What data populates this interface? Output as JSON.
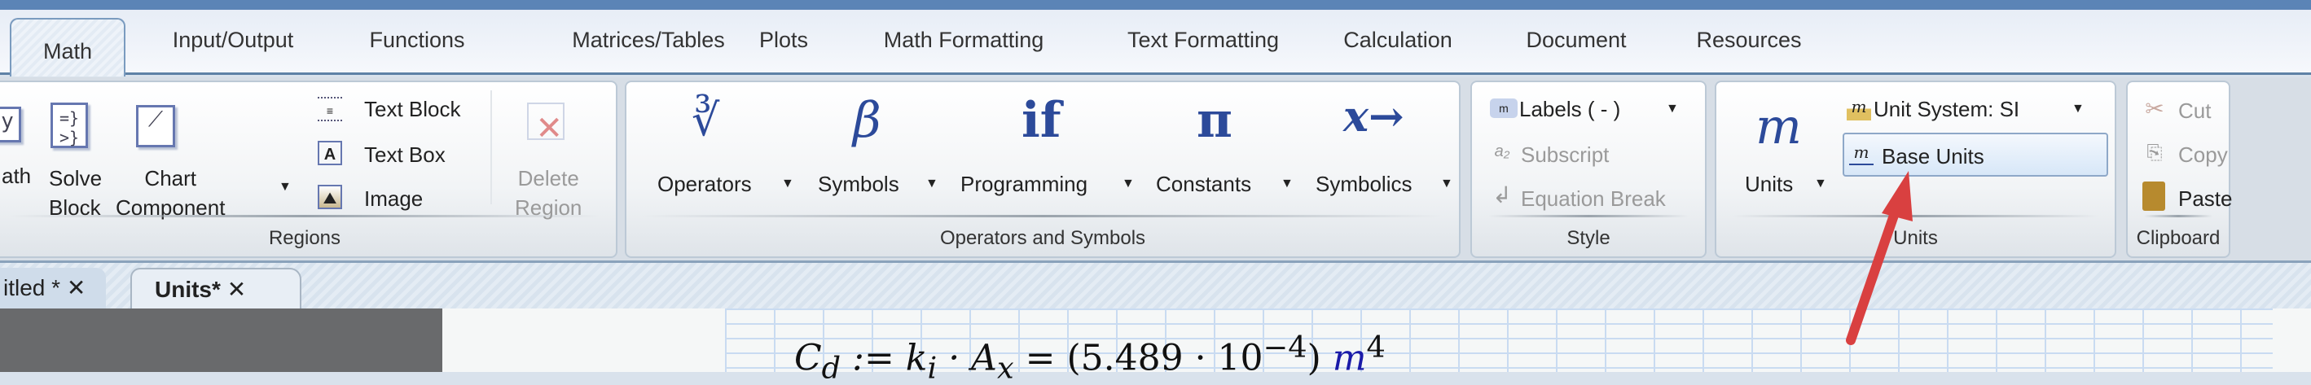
{
  "tabs": [
    "Math",
    "Input/Output",
    "Functions",
    "Matrices/Tables",
    "Plots",
    "Math Formatting",
    "Text Formatting",
    "Calculation",
    "Document",
    "Resources"
  ],
  "regions": {
    "math_partial": "ath",
    "solve_block": [
      "Solve",
      "Block"
    ],
    "chart_component": [
      "Chart",
      "Component"
    ],
    "text_block": "Text Block",
    "text_box": "Text Box",
    "image": "Image",
    "delete_region": [
      "Delete",
      "Region"
    ],
    "group_label": "Regions"
  },
  "operators": {
    "items": [
      "Operators",
      "Symbols",
      "Programming",
      "Constants",
      "Symbolics"
    ],
    "icons": [
      "∛",
      "β",
      "if",
      "π",
      "x→"
    ],
    "group_label": "Operators and Symbols"
  },
  "style": {
    "labels": "Labels  ( - )",
    "subscript": "Subscript",
    "equation_break": "Equation Break",
    "group_label": "Style"
  },
  "units": {
    "units": "Units",
    "unit_system": "Unit System:  SI",
    "base_units": "Base Units",
    "group_label": "Units"
  },
  "clipboard": {
    "cut": "Cut",
    "copy": "Copy",
    "paste": "Paste",
    "group_label": "Clipboard"
  },
  "doc_tabs": [
    "itled *",
    "Units*"
  ],
  "equation": {
    "lhs": "C",
    "lhs_sub": "d",
    "assign": " := k",
    "k_sub": "i",
    "times": " · A",
    "a_sub": "x",
    "result": " = (5.489 · 10",
    "exp": "−4",
    "close": ") ",
    "unit": "m",
    "unit_exp": "4"
  },
  "colors": {
    "accent": "#5b84b6",
    "arrow": "#d94040",
    "unit": "#1a1aa8"
  }
}
